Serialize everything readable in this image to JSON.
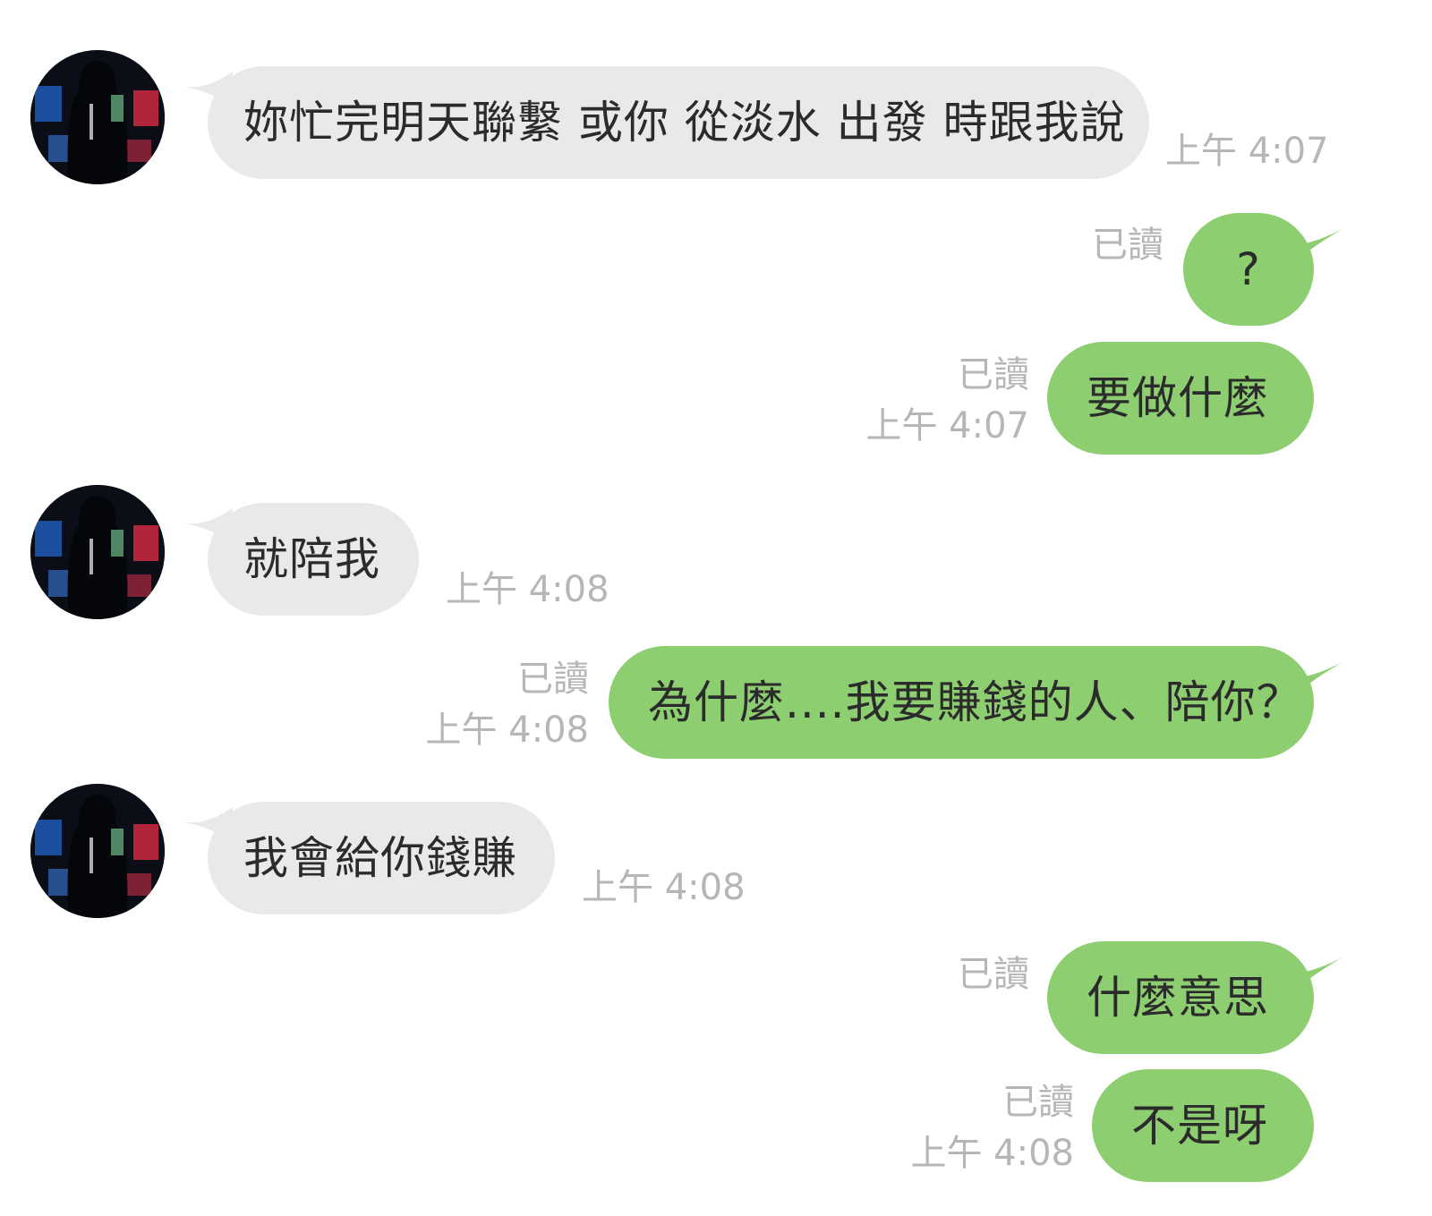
{
  "colors": {
    "incoming_bubble": "#e9e9eb",
    "outgoing_bubble": "#8dce71",
    "meta_text": "#b6b6b6",
    "message_text": "#2b2b2b"
  },
  "contact_avatar_icon": "contact-avatar-photo",
  "messages": [
    {
      "direction": "incoming",
      "text": "妳忙完明天聯繫 或你 從淡水 出發 時跟我說",
      "time": "上午 4:07"
    },
    {
      "direction": "outgoing",
      "text": "?",
      "read": "已讀",
      "time": ""
    },
    {
      "direction": "outgoing",
      "text": "要做什麼",
      "read": "已讀",
      "time": "上午 4:07"
    },
    {
      "direction": "incoming",
      "text": "就陪我",
      "time": "上午 4:08"
    },
    {
      "direction": "outgoing",
      "text": "為什麼....我要賺錢的人、陪你？",
      "read": "已讀",
      "time": "上午 4:08"
    },
    {
      "direction": "incoming",
      "text": "我會給你錢賺",
      "time": "上午 4:08"
    },
    {
      "direction": "outgoing",
      "text": "什麼意思",
      "read": "已讀",
      "time": ""
    },
    {
      "direction": "outgoing",
      "text": "不是呀",
      "read": "已讀",
      "time": "上午 4:08"
    }
  ]
}
